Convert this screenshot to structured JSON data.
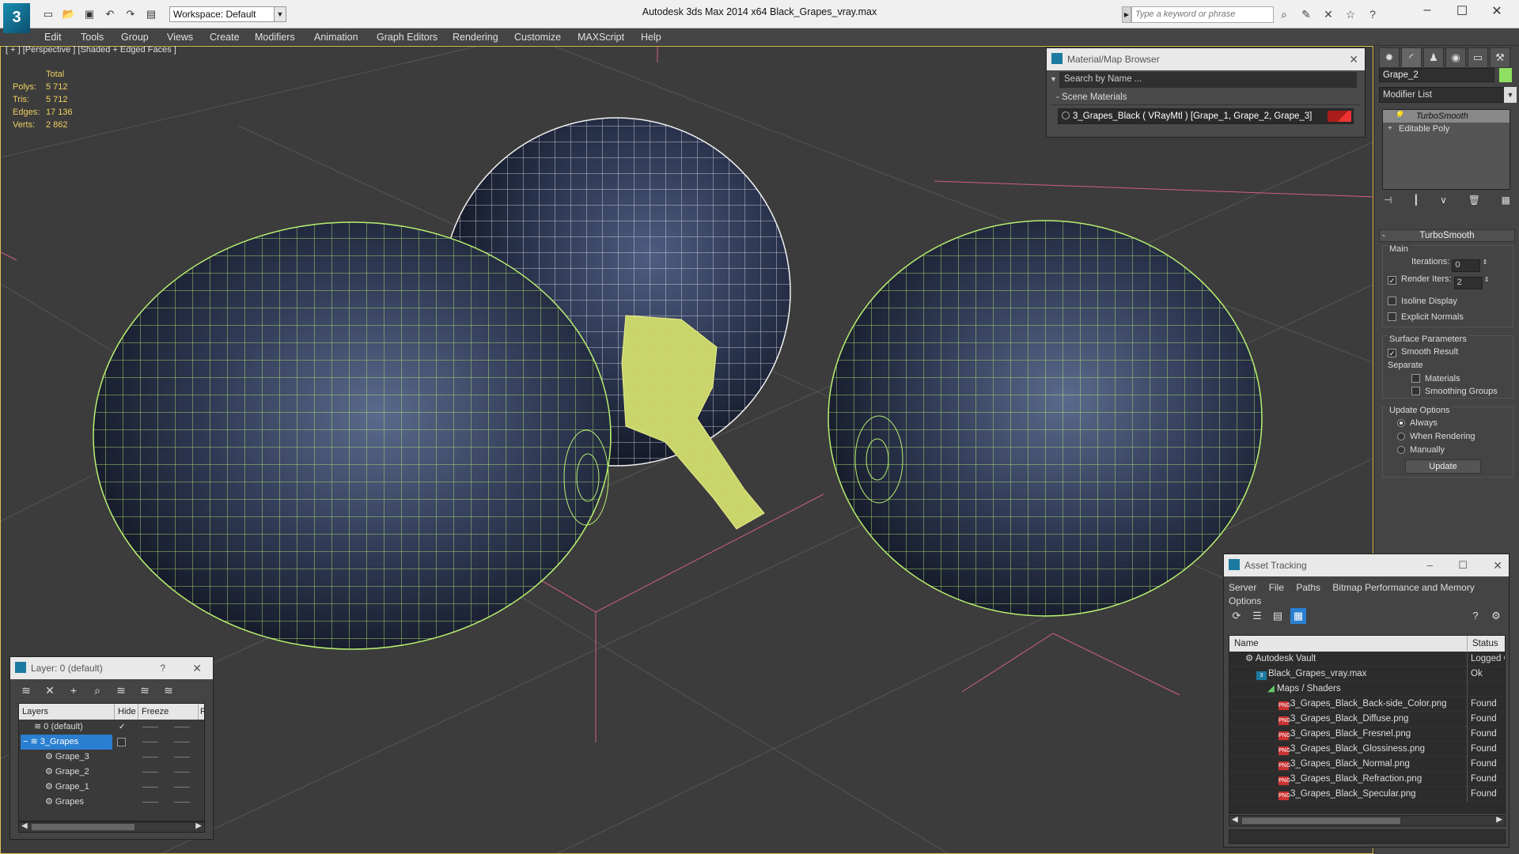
{
  "titlebar": {
    "app_title": "Autodesk 3ds Max  2014 x64      Black_Grapes_vray.max",
    "workspace": "Workspace: Default",
    "search_placeholder": "Type a keyword or phrase",
    "logo": "3"
  },
  "menu": [
    "Edit",
    "Tools",
    "Group",
    "Views",
    "Create",
    "Modifiers",
    "Animation",
    "Graph Editors",
    "Rendering",
    "Customize",
    "MAXScript",
    "Help"
  ],
  "viewport": {
    "label": "[ + ] [Perspective ] [Shaded + Edged Faces ]",
    "stats": {
      "header": "Total",
      "polys_label": "Polys:",
      "polys": "5 712",
      "tris_label": "Tris:",
      "tris": "5 712",
      "edges_label": "Edges:",
      "edges": "17 136",
      "verts_label": "Verts:",
      "verts": "2 862"
    }
  },
  "material_browser": {
    "title": "Material/Map Browser",
    "search_placeholder": "Search by Name ...",
    "section": "- Scene Materials",
    "material": "3_Grapes_Black  ( VRayMtl )  [Grape_1, Grape_2, Grape_3]"
  },
  "command_panel": {
    "object_name": "Grape_2",
    "modifier_list": "Modifier List",
    "stack": [
      "TurboSmooth",
      "Editable Poly"
    ],
    "rollout_title": "TurboSmooth",
    "main_label": "Main",
    "iterations_label": "Iterations:",
    "iterations": "0",
    "render_iters_label": "Render Iters:",
    "render_iters": "2",
    "isoline_label": "Isoline Display",
    "explicit_normals_label": "Explicit Normals",
    "surface_label": "Surface Parameters",
    "smooth_result_label": "Smooth Result",
    "separate_label": "Separate",
    "materials_label": "Materials",
    "smoothing_groups_label": "Smoothing Groups",
    "update_options_label": "Update Options",
    "always_label": "Always",
    "when_rendering_label": "When Rendering",
    "manually_label": "Manually",
    "update_button": "Update"
  },
  "asset_tracking": {
    "title": "Asset Tracking",
    "menu": [
      "Server",
      "File",
      "Paths",
      "Bitmap Performance and Memory"
    ],
    "menu2": "Options",
    "col_name": "Name",
    "col_status": "Status",
    "rows": [
      {
        "name": "Autodesk Vault",
        "status": "Logged O"
      },
      {
        "name": "Black_Grapes_vray.max",
        "status": "Ok"
      },
      {
        "name": "Maps / Shaders",
        "status": ""
      },
      {
        "name": "3_Grapes_Black_Back-side_Color.png",
        "status": "Found"
      },
      {
        "name": "3_Grapes_Black_Diffuse.png",
        "status": "Found"
      },
      {
        "name": "3_Grapes_Black_Fresnel.png",
        "status": "Found"
      },
      {
        "name": "3_Grapes_Black_Glossiness.png",
        "status": "Found"
      },
      {
        "name": "3_Grapes_Black_Normal.png",
        "status": "Found"
      },
      {
        "name": "3_Grapes_Black_Refraction.png",
        "status": "Found"
      },
      {
        "name": "3_Grapes_Black_Specular.png",
        "status": "Found"
      }
    ]
  },
  "layer_panel": {
    "title": "Layer: 0 (default)",
    "help": "?",
    "col_layers": "Layers",
    "col_hide": "Hide",
    "col_freeze": "Freeze",
    "col_r": "R",
    "rows": [
      "0 (default)",
      "3_Grapes",
      "Grape_3",
      "Grape_2",
      "Grape_1",
      "Grapes"
    ]
  },
  "colors": {
    "wire_green": "#b8f070",
    "selection_blue": "#2a7fd0",
    "stats_yellow": "#f0d060"
  }
}
